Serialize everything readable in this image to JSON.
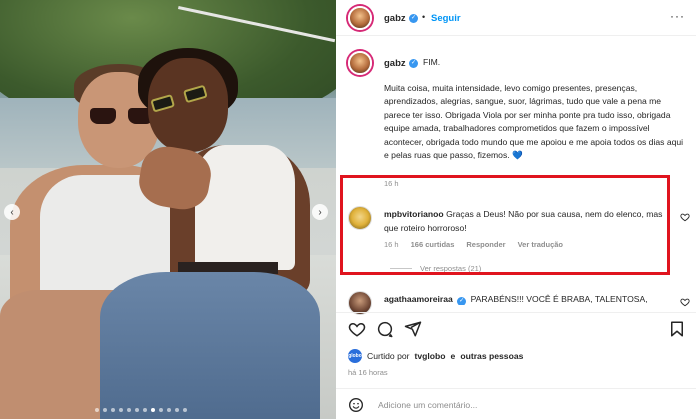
{
  "post": {
    "author": "gabz",
    "follow_label": "Seguir",
    "more_icon": "more-horizontal-icon",
    "caption_author": "gabz",
    "caption_title": "FIM.",
    "caption_body": "Muita coisa, muita intensidade, levo comigo presentes, presenças, aprendizados, alegrias, sangue, suor, lágrimas, tudo que vale a pena me parece ter isso. Obrigada Viola por ser minha ponte pra tudo isso, obrigada equipe amada, trabalhadores comprometidos que fazem o impossível acontecer, obrigada todo mundo que me apoiou e me apoia todos os dias aqui e pelas ruas que passo, fizemos. 💙",
    "caption_time": "16 h"
  },
  "comments": [
    {
      "author": "mpbvitorianoo",
      "text": "Graças a Deus! Não por sua causa, nem do elenco, mas que roteiro horroroso!",
      "time": "16 h",
      "likes": "166 curtidas",
      "reply_label": "Responder",
      "translate_label": "Ver tradução",
      "view_replies": "Ver respostas (21)"
    },
    {
      "author": "agathaamoreiraa",
      "text": "PARABÉNS!!! VOCÊ É BRABA, TALENTOSA,"
    }
  ],
  "likes_line": {
    "prefix": "Curtido por",
    "user": "tvglobo",
    "connector": "e",
    "others": "outras pessoas",
    "avatar_label": "globo"
  },
  "post_time": "há 16 horas",
  "comment_box": {
    "placeholder": "Adicione um comentário..."
  },
  "carousel": {
    "total_slides": 12,
    "active_index": 7
  },
  "colors": {
    "accent": "#0095f6",
    "highlight": "#e0141e",
    "verified": "#3897f0"
  }
}
